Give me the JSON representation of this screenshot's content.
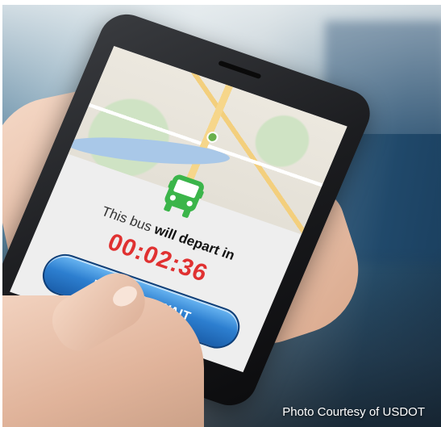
{
  "app": {
    "map_alt": "city-map",
    "depart_prefix": "This bus ",
    "depart_bold": "will depart in",
    "countdown": "00:02:36",
    "request_button": "REQUEST WAIT"
  },
  "caption": "Photo Courtesy of USDOT",
  "colors": {
    "timer": "#e03131",
    "bus_icon": "#3bb54a",
    "button": "#2d7fd0"
  }
}
